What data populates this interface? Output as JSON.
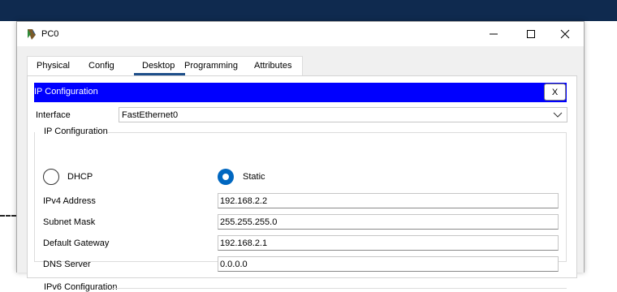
{
  "window": {
    "title": "PC0",
    "close_glyph": "✕",
    "minimize_glyph": "—",
    "maximize_glyph": "☐"
  },
  "tabs": [
    {
      "label": "Physical",
      "active": false
    },
    {
      "label": "Config",
      "active": false
    },
    {
      "label": "Desktop",
      "active": true
    },
    {
      "label": "Programming",
      "active": false
    },
    {
      "label": "Attributes",
      "active": false
    }
  ],
  "ip_config": {
    "header_title": "IP Configuration",
    "close_button_label": "X",
    "interface_label": "Interface",
    "interface_value": "FastEthernet0",
    "group_label": "IP Configuration",
    "dhcp_label": "DHCP",
    "static_label": "Static",
    "mode_selected": "Static",
    "fields": {
      "ipv4_label": "IPv4 Address",
      "ipv4_value": "192.168.2.2",
      "subnet_label": "Subnet Mask",
      "subnet_value": "255.255.255.0",
      "gateway_label": "Default Gateway",
      "gateway_value": "192.168.2.1",
      "dns_label": "DNS Server",
      "dns_value": "0.0.0.0"
    },
    "ipv6_group_label": "IPv6 Configuration"
  },
  "colors": {
    "header_blue": "#0000ff",
    "radio_selected": "#0067c0",
    "active_tab_underline": "#1d4e89",
    "top_bar": "#0f2a4f"
  }
}
